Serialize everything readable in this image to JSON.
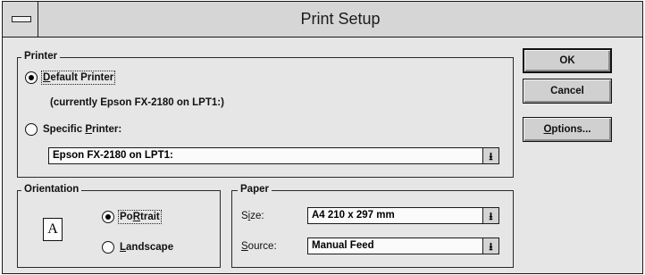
{
  "window": {
    "title": "Print Setup"
  },
  "printer": {
    "legend": "Printer",
    "default_label_hot": "D",
    "default_label_rest": "efault Printer",
    "current_note": "(currently Epson FX-2180 on LPT1:)",
    "specific_label_pre": "Specific ",
    "specific_label_hot": "P",
    "specific_label_rest": "rinter:",
    "selected": "default",
    "specific_value": "Epson FX-2180 on LPT1:"
  },
  "orientation": {
    "legend": "Orientation",
    "icon_letter": "A",
    "portrait_hot": "R",
    "portrait_pre": "Po",
    "portrait_rest": "trait",
    "landscape_hot": "L",
    "landscape_rest": "andscape",
    "selected": "portrait"
  },
  "paper": {
    "legend": "Paper",
    "size_label_pre": "S",
    "size_label_hot": "i",
    "size_label_rest": "ze:",
    "size_value": "A4 210 x 297 mm",
    "source_label_hot": "S",
    "source_label_rest": "ource:",
    "source_value": "Manual Feed"
  },
  "buttons": {
    "ok": "OK",
    "cancel": "Cancel",
    "options_hot": "O",
    "options_rest": "ptions..."
  },
  "icons": {
    "system_menu": "system-menu-icon",
    "dropdown": "dropdown-arrow-icon",
    "dropdown_glyph": "⭳"
  }
}
